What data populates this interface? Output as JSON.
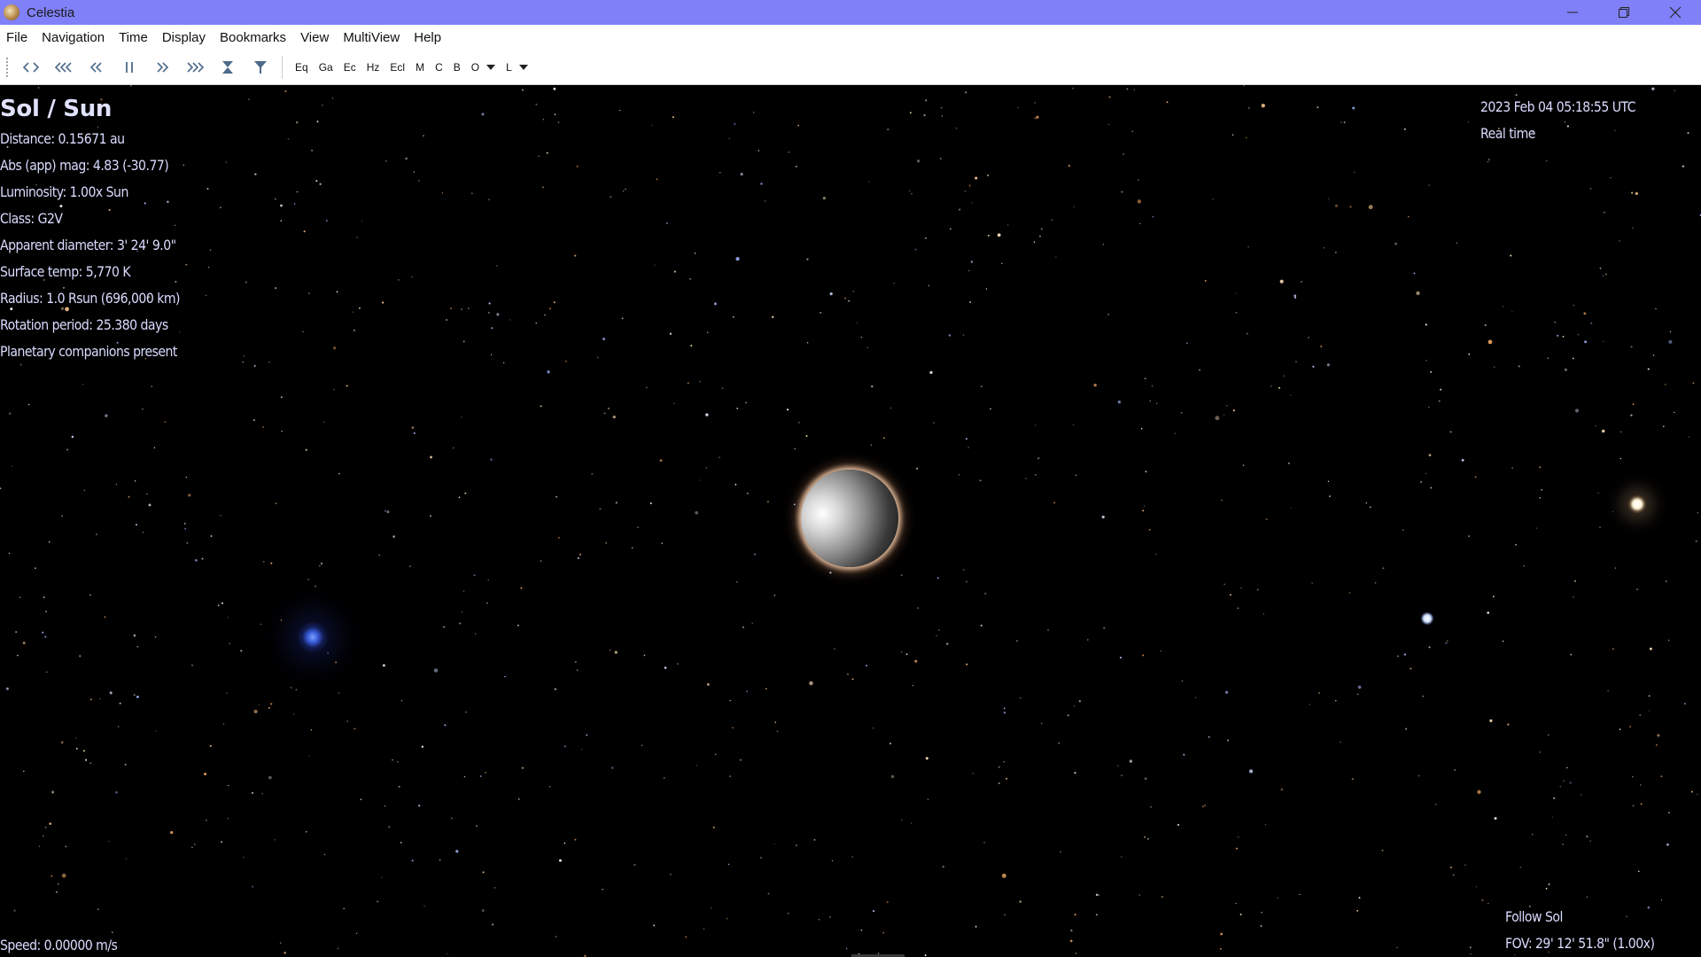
{
  "window": {
    "title": "Celestia",
    "icon": "celestia-planet-icon",
    "controls": [
      "minimize-icon",
      "restore-icon",
      "close-icon"
    ]
  },
  "menu": {
    "file": "File",
    "navigation": "Navigation",
    "time": "Time",
    "display": "Display",
    "bookmarks": "Bookmarks",
    "view": "View",
    "multiview": "MultiView",
    "help": "Help"
  },
  "toolbar": {
    "time_buttons": [
      "reverse-time-icon",
      "ten-times-slower-reverse-icon",
      "slower-reverse-icon",
      "pause-icon",
      "faster-icon",
      "ten-times-faster-icon",
      "set-to-now-icon",
      "set-time-icon"
    ],
    "labels": {
      "eq": "Eq",
      "ga": "Ga",
      "ec": "Ec",
      "hz": "Hz",
      "ecl": "Ecl",
      "m": "M",
      "c": "C",
      "b": "B",
      "o": "O",
      "l": "L"
    }
  },
  "hud": {
    "object_title": "Sol / Sun",
    "distance": "Distance: 0.15671 au",
    "magnitude": "Abs (app) mag: 4.83 (-30.77)",
    "luminosity": "Luminosity: 1.00x Sun",
    "class": "Class: G2V",
    "apparent_diameter": "Apparent diameter: 3' 24' 9.0\"",
    "surface_temp": "Surface temp: 5,770 K",
    "radius": "Radius: 1.0 Rsun  (696,000 km)",
    "rotation": "Rotation period: 25.380 days",
    "companions": "Planetary companions present",
    "datetime": "2023 Feb 04 05:18:55 UTC",
    "time_mode": "Real time",
    "speed": "Speed: 0.00000 m/s",
    "follow": "Follow Sol",
    "fov": "FOV: 29' 12' 51.8\" (1.00x)"
  },
  "colors": {
    "titlebar": "#8080f8",
    "hud_text": "#d9dcff",
    "space": "#000000"
  }
}
